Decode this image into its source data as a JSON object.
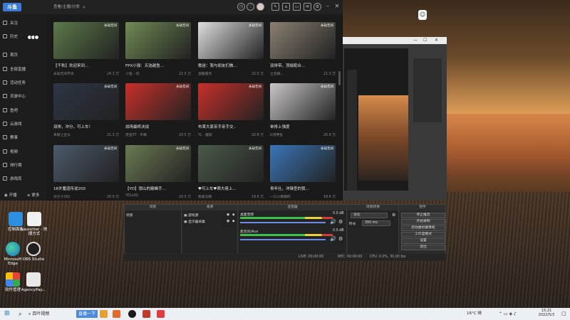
{
  "desktop": {
    "icons": [
      {
        "label": "控制面板"
      },
      {
        "label": "Launcher - 快捷方式"
      },
      {
        "label": "Microsoft Edge"
      },
      {
        "label": "OBS Studio"
      },
      {
        "label": "软件管理"
      },
      {
        "label": "AgencyPay..."
      }
    ]
  },
  "app": {
    "logo": "斗鱼",
    "search_placeholder": "查看/主播/分类",
    "sidebar": {
      "items": [
        {
          "label": "关注"
        },
        {
          "label": "历史"
        },
        {
          "label": "首页"
        },
        {
          "label": "全部直播"
        },
        {
          "label": "活动任务"
        },
        {
          "label": "灵游中心"
        },
        {
          "label": "鱼吧"
        },
        {
          "label": "云游戏"
        },
        {
          "label": "赛事"
        },
        {
          "label": "视频"
        },
        {
          "label": "排行榜"
        },
        {
          "label": "游戏库"
        }
      ],
      "bottom": {
        "broadcast": "开播",
        "more": "更多"
      }
    },
    "cards": [
      {
        "title": "【千秋】欢迎来到...",
        "channel": "永劫无间学员",
        "views": "24.3 万",
        "tag": "永劫无间",
        "color": "#5c7a4a"
      },
      {
        "title": "FPX小强：天选越鱼...",
        "channel": "小强 - IQ",
        "views": "22.5 万",
        "tag": "永劫无间",
        "color": "#6f8a54"
      },
      {
        "title": "歌迷：我与朋友们做...",
        "channel": "温暖服务",
        "views": "22.5 万",
        "tag": "永劫无间",
        "color": "#dedede"
      },
      {
        "title": "双排带，顶级配合...",
        "channel": "土豆解...",
        "views": "21.3 万",
        "tag": "永劫无间",
        "color": "#8a8070"
      },
      {
        "title": "双排，冲分，可上车！",
        "channel": "奉献土豆头",
        "views": "21.3 万",
        "tag": "永劫无间",
        "color": "#2c3646"
      },
      {
        "title": "战场最终决战",
        "channel": "赏金5T · 专属",
        "views": "20.5 万",
        "tag": "永劫无间",
        "color": "#c8302b"
      },
      {
        "title": "布莱大家亲手亲手交..",
        "channel": "YL · 鲤跃",
        "views": "20.8 万",
        "tag": "永劫无间",
        "color": "#c8302b"
      },
      {
        "title": "单排上强度",
        "channel": "U渣神鱼",
        "views": "20.9 万",
        "tag": "永劫无间",
        "color": "#c9c7c8"
      },
      {
        "title": "18岁魔道传说200",
        "channel": "亦方寸(IQ)",
        "views": "20.9 万",
        "tag": "永劫无间",
        "color": "#4c5a6a"
      },
      {
        "title": "【YD】锁山的巅峰手...",
        "channel": "YD(xiQ)",
        "views": "20.5 万",
        "tag": "永劫无间",
        "color": "#6a7a52"
      },
      {
        "title": "♥可上车♥萌大佬上...",
        "channel": "我爱乐刷",
        "views": "19.6 万",
        "tag": "永劫无间",
        "color": "#4a5a48"
      },
      {
        "title": "青年仕，冲锋型的我...",
        "channel": "一口小鲸鲸的",
        "views": "18.6 万",
        "tag": "永劫无间",
        "color": "#3a76b8"
      }
    ]
  },
  "obs": {
    "panels": {
      "scenes": "场景",
      "sources": "来源",
      "mixer": "混音器",
      "transitions": "场景转换",
      "controls": "控件"
    },
    "scene_item": "场景",
    "sources_items": [
      "游戏源",
      "显示器采集"
    ],
    "mixer": [
      {
        "name": "桌面音频",
        "db": "0.0 dB"
      },
      {
        "name": "麦克风/Aux",
        "db": "0.0 dB"
      }
    ],
    "transition": {
      "type": "淡化",
      "duration_label": "时长",
      "duration": "300 ms"
    },
    "controls": [
      "停止推流",
      "开始录制",
      "启动虚拟摄像机",
      "工作室模式",
      "设置",
      "退出"
    ],
    "status": {
      "live": "LIVE: 00:00:00",
      "rec": "REC: 00:00:00",
      "cpu": "CPU: 0.0%, 30.00 fps"
    }
  },
  "taskbar": {
    "search_label": "百叶视频",
    "highlight": "直播一下",
    "weather": "16°C 晴",
    "time": "15:21",
    "date": "2022/5/3"
  }
}
